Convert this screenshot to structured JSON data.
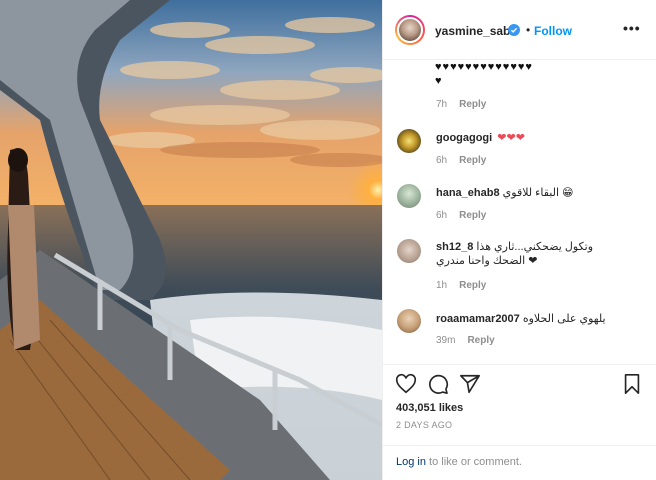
{
  "post": {
    "username": "yasmine_sabri",
    "separator": "•",
    "follow_label": "Follow",
    "more_label": "•••"
  },
  "comments": [
    {
      "text_line1": "♥♥♥♥♥♥♥♥♥♥♥♥♥",
      "text_line2": "♥",
      "time": "7h",
      "reply": "Reply"
    },
    {
      "username": "googagogi",
      "text": "❤❤❤",
      "time": "6h",
      "reply": "Reply"
    },
    {
      "username": "hana_ehab8",
      "text": "البقاء للاقوي 😁",
      "time": "6h",
      "reply": "Reply"
    },
    {
      "username": "sh12_8",
      "text_line1": "وتكول يضحكني...ثاري هذا",
      "text_line2": "الضحك واحنا مندري ❤",
      "time": "1h",
      "reply": "Reply"
    },
    {
      "username": "roaamamar2007",
      "text": "يلهوي على الحلاوه",
      "time": "39m",
      "reply": "Reply"
    }
  ],
  "actions": {
    "likes": "403,051 likes",
    "date": "2 DAYS AGO"
  },
  "login": {
    "link": "Log in",
    "rest": " to like or comment."
  },
  "colors": {
    "accent": "#0095f6",
    "heart_red": "#ed4956"
  }
}
